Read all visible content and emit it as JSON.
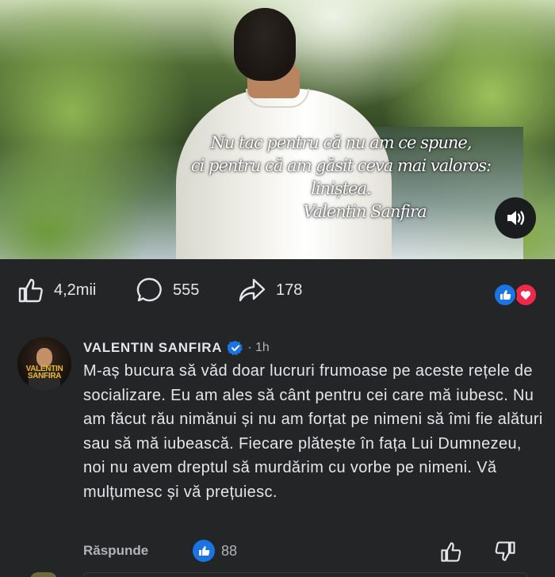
{
  "video": {
    "quote_lines": [
      "Nu tac pentru că nu am ce spune,",
      "ci pentru că am găsit ceva mai valoros:",
      "liniștea."
    ],
    "quote_author": "Valentin Sanfira",
    "volume_icon": "speaker-wave-icon"
  },
  "engagement": {
    "likes": "4,2mii",
    "comments": "555",
    "shares": "178",
    "reaction_icons": [
      "like-icon",
      "love-icon"
    ],
    "colors": {
      "like": "#1b74e4",
      "love": "#f0284a"
    }
  },
  "comment": {
    "author": "VALENTIN SANFIRA",
    "time": "· 1h",
    "avatar_text": {
      "title": "VALENTIN SANFIRA",
      "subtitle": ""
    },
    "text": "M-aș bucura să văd doar lucruri frumoase pe aceste rețele de socializare. Eu am ales să cânt pentru cei care mă iubesc. Nu am făcut rău nimănui și nu am forțat pe nimeni să îmi fie alături sau să mă iubească. Fiecare plătește în fața Lui Dumnezeu, noi nu avem dreptul să murdărim cu vorbe pe nimeni. Vă mulțumesc și vă prețuiesc.",
    "reply_label": "Răspunde",
    "like_count": "88",
    "verified_color": "#1b74e4"
  }
}
